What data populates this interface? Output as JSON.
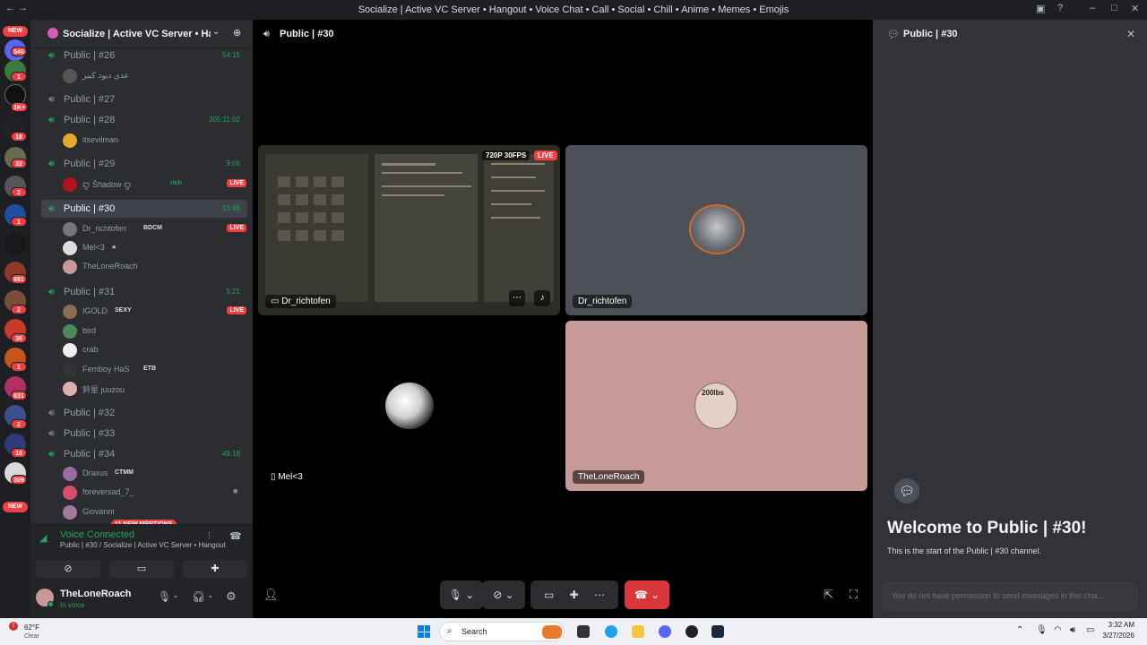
{
  "window": {
    "title": "Socialize | Active VC Server • Hangout • Voice Chat • Call • Social • Chill • Anime • Memes • Emojis"
  },
  "rail": {
    "new_top": "NEW",
    "new_bottom": "NEW",
    "badges": [
      "540",
      "1",
      "1K+",
      "18",
      "32",
      "2",
      "1",
      "891",
      "2",
      "36",
      "1",
      "631",
      "2",
      "10",
      "309"
    ]
  },
  "server": {
    "name": "Socialize | Active VC Server • Han..."
  },
  "channels": [
    {
      "label": "Public | #26",
      "time": "54:15",
      "users": [
        {
          "name": "عدي ديود كبير",
          "tag": "",
          "live": false
        }
      ]
    },
    {
      "label": "Public | #27",
      "time": "",
      "users": []
    },
    {
      "label": "Public | #28",
      "time": "305:11:02",
      "users": [
        {
          "name": "itsevilman",
          "tag": "",
          "live": false
        }
      ]
    },
    {
      "label": "Public | #29",
      "time": "9:06",
      "users": [
        {
          "name": "ꨄ︎ Ŝhadow ꨄ︎",
          "tag": "rich",
          "live": true
        }
      ]
    },
    {
      "label": "Public | #30",
      "time": "10:45",
      "users": [
        {
          "name": "Dr_richtofen",
          "tag": "BDCM",
          "live": true
        },
        {
          "name": "Mel<3",
          "tag": "★",
          "live": false
        },
        {
          "name": "TheLoneRoach",
          "tag": "",
          "live": false
        }
      ]
    },
    {
      "label": "Public | #31",
      "time": "5:21",
      "users": [
        {
          "name": "IGOLD",
          "tag": "SEXY",
          "live": true
        },
        {
          "name": "bird",
          "tag": "",
          "live": false
        },
        {
          "name": "crab",
          "tag": "",
          "live": false
        },
        {
          "name": "Femboy HaS",
          "tag": "ETB",
          "live": false
        },
        {
          "name": "鈴星 juuzou",
          "tag": "",
          "live": false
        }
      ]
    },
    {
      "label": "Public | #32",
      "time": "",
      "users": []
    },
    {
      "label": "Public | #33",
      "time": "",
      "users": []
    },
    {
      "label": "Public | #34",
      "time": "49:18",
      "users": [
        {
          "name": "Draxus",
          "tag": "CTMM",
          "live": false
        },
        {
          "name": "foreversad_7_",
          "tag": "",
          "live": false
        },
        {
          "name": "Giovanni",
          "tag": "",
          "live": false
        }
      ]
    }
  ],
  "live_label": "LIVE",
  "mentions": "11 NEW MENTIONS",
  "voice": {
    "status": "Voice Connected",
    "location": "Public | #30 / Socialize | Active VC Server • Hangout..."
  },
  "user": {
    "name": "TheLoneRoach",
    "status": "In voice"
  },
  "stage": {
    "channel": "Public | #30",
    "quality": "720P 30FPS",
    "live": "LIVE",
    "tiles": [
      "Dr_richtofen",
      "Dr_richtofen",
      "Mel<3",
      "TheLoneRoach"
    ],
    "avatar_text": "200lbs"
  },
  "chat": {
    "channel": "Public | #30",
    "welcome": "Welcome to Public | #30!",
    "sub": "This is the start of the Public | #30 channel.",
    "placeholder": "You do not have permission to send messages in this cha..."
  },
  "taskbar": {
    "temp": "62°F",
    "weather": "Clear",
    "search": "Search",
    "time": "3:32 AM",
    "date": "3/27/2026"
  },
  "colors": {
    "accent_green": "#23a55a",
    "live_red": "#f23f43",
    "tile_pink": "#c79a98",
    "tile_gray": "#4e5058"
  }
}
